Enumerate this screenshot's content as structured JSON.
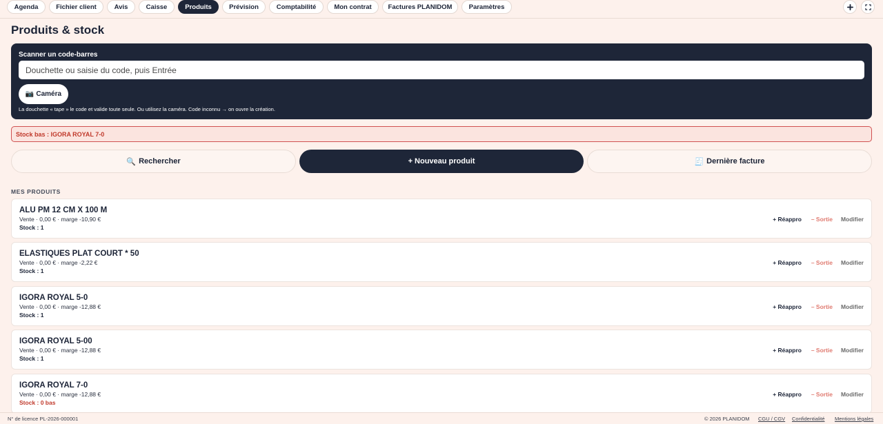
{
  "nav": {
    "tabs": [
      {
        "label": "Agenda"
      },
      {
        "label": "Fichier client"
      },
      {
        "label": "Avis"
      },
      {
        "label": "Caisse"
      },
      {
        "label": "Produits",
        "active": true
      },
      {
        "label": "Prévision"
      },
      {
        "label": "Comptabilité"
      },
      {
        "label": "Mon contrat"
      },
      {
        "label": "Factures PLANIDOM"
      },
      {
        "label": "Paramètres"
      }
    ],
    "add_icon": "plus-icon",
    "fullscreen_icon": "fullscreen-icon"
  },
  "page": {
    "title": "Produits & stock"
  },
  "scanner": {
    "label": "Scanner un code-barres",
    "input_placeholder": "Douchette ou saisie du code, puis Entrée",
    "input_value": "",
    "camera_label": "Caméra",
    "camera_icon_glyph": "📷",
    "help": "La douchette « tape » le code et valide toute seule. Ou utilisez la caméra. Code inconnu → on ouvre la création."
  },
  "alert": {
    "text": "Stock bas : IGORA ROYAL 7-0"
  },
  "actions": {
    "search_label": "Rechercher",
    "search_icon_glyph": "🔍",
    "new_product_label": "+ Nouveau produit",
    "last_invoice_label": "Dernière facture",
    "last_invoice_icon_glyph": "🧾"
  },
  "products_section": {
    "heading": "MES PRODUITS",
    "reappro_label": "+ Réappro",
    "sortie_label": "– Sortie",
    "modifier_label": "Modifier",
    "items": [
      {
        "name": "ALU PM 12 CM X 100 M",
        "price_line": "Vente · 0,00 € · marge -10,90 €",
        "stock": "Stock : 1",
        "low": false
      },
      {
        "name": "ELASTIQUES PLAT COURT * 50",
        "price_line": "Vente · 0,00 € · marge -2,22 €",
        "stock": "Stock : 1",
        "low": false
      },
      {
        "name": "IGORA ROYAL 5-0",
        "price_line": "Vente · 0,00 € · marge -12,88 €",
        "stock": "Stock : 1",
        "low": false
      },
      {
        "name": "IGORA ROYAL 5-00",
        "price_line": "Vente · 0,00 € · marge -12,88 €",
        "stock": "Stock : 1",
        "low": false
      },
      {
        "name": "IGORA ROYAL 7-0",
        "price_line": "Vente · 0,00 € · marge -12,88 €",
        "stock": "Stock : 0 bas",
        "low": true
      }
    ]
  },
  "footer": {
    "license": "N° de licence PL-2026-000001",
    "copyright": "© 2026 PLANIDOM",
    "cgu": "CGU / CGV",
    "privacy": "Confidentialité",
    "legal": "Mentions légales"
  },
  "colors": {
    "background": "#fdf1ec",
    "dark": "#1e2638",
    "danger": "#c0392b",
    "sortie": "#e07a70"
  }
}
